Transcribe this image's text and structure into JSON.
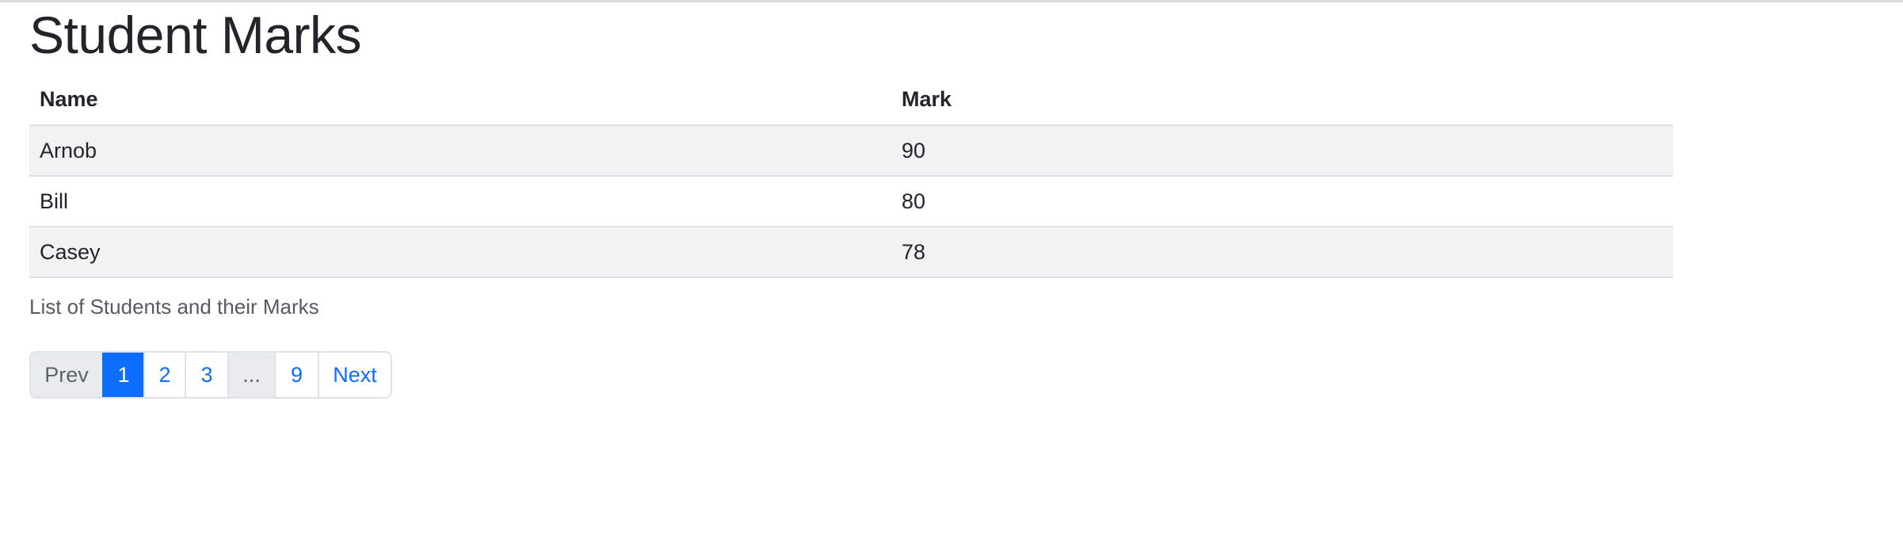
{
  "page": {
    "title": "Student Marks",
    "caption": "List of Students and their Marks"
  },
  "table": {
    "headers": [
      "Name",
      "Mark"
    ],
    "rows": [
      {
        "name": "Arnob",
        "mark": "90"
      },
      {
        "name": "Bill",
        "mark": "80"
      },
      {
        "name": "Casey",
        "mark": "78"
      }
    ]
  },
  "pagination": {
    "prev_label": "Prev",
    "pages": [
      "1",
      "2",
      "3"
    ],
    "ellipsis": "...",
    "last_page": "9",
    "next_label": "Next",
    "current_page": "1"
  },
  "colors": {
    "link": "#0d6efd",
    "active_bg": "#0d6efd",
    "stripe_bg": "#f2f2f2",
    "disabled_bg": "#e9ecef"
  }
}
